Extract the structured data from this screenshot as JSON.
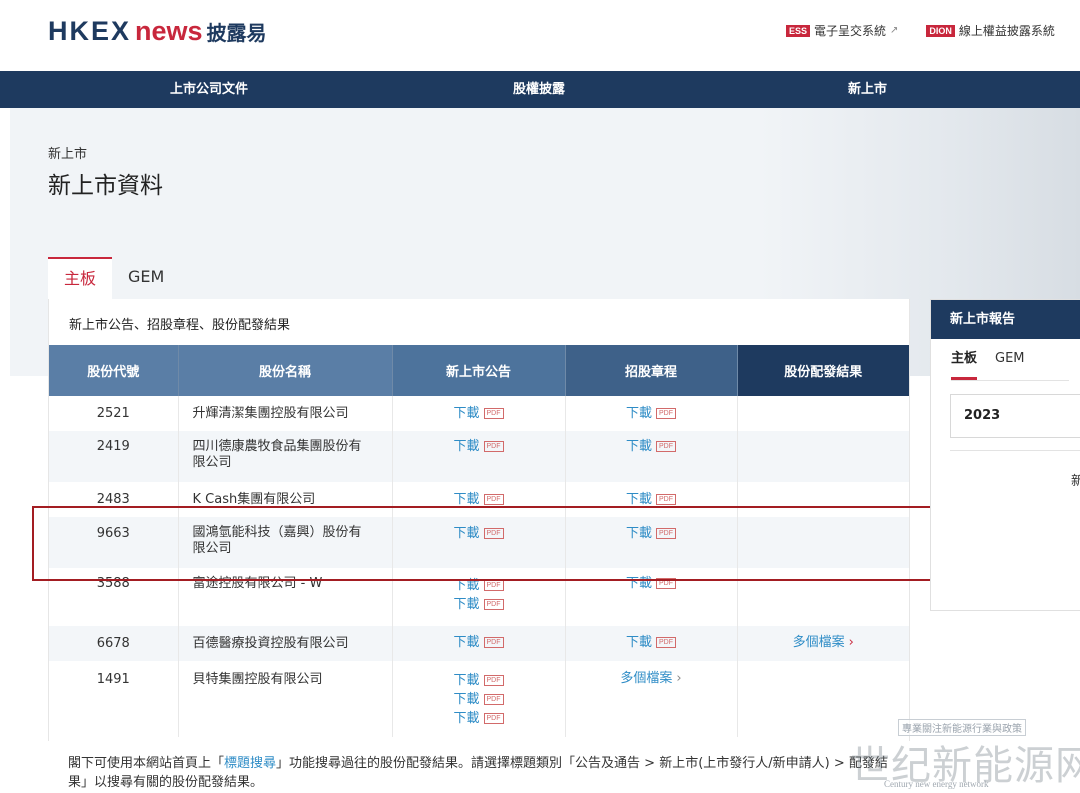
{
  "header": {
    "logo": {
      "hkex": "HKEX",
      "news": "news",
      "zh": "披露易"
    },
    "links": [
      {
        "tag": "ESS",
        "label": "電子呈交系統"
      },
      {
        "tag": "DION",
        "label": "線上權益披露系統"
      }
    ]
  },
  "nav": {
    "items": [
      "上市公司文件",
      "股權披露",
      "新上市"
    ]
  },
  "page": {
    "breadcrumb": "新上市",
    "title": "新上市資料"
  },
  "tabs": [
    "主板",
    "GEM"
  ],
  "panel": {
    "title": "新上市公告、招股章程、股份配發結果"
  },
  "table": {
    "headers": [
      "股份代號",
      "股份名稱",
      "新上市公告",
      "招股章程",
      "股份配發結果"
    ],
    "download_label": "下載",
    "pdf_label": "PDF",
    "multi_label": "多個檔案",
    "rows": [
      {
        "code": "2521",
        "name": "升輝清潔集團控股有限公司"
      },
      {
        "code": "2419",
        "name": "四川德康農牧食品集團股份有限公司"
      },
      {
        "code": "2483",
        "name": "K Cash集團有限公司"
      },
      {
        "code": "9663",
        "name": "國鴻氫能科技（嘉興）股份有限公司"
      },
      {
        "code": "3588",
        "name": "富途控股有限公司 - W"
      },
      {
        "code": "6678",
        "name": "百德醫療投資控股有限公司"
      },
      {
        "code": "1491",
        "name": "貝特集團控股有限公司"
      }
    ]
  },
  "side": {
    "title": "新上市報告",
    "tabs": [
      "主板",
      "GEM"
    ],
    "year": "2023",
    "cut_text": "新"
  },
  "footnote": {
    "part1": "閣下可使用本網站首頁上「",
    "link": "標題搜尋",
    "part2": "」功能搜尋過往的股份配發結果。請選擇標題類別「公告及通告 > 新上市(上市發行人/新申請人) > 配發結果」以搜尋有關的股份配發結果。"
  },
  "watermark": {
    "small": "專業關注新能源行業與政策",
    "big": "世纪新能源网",
    "en": "Century new energy network"
  }
}
